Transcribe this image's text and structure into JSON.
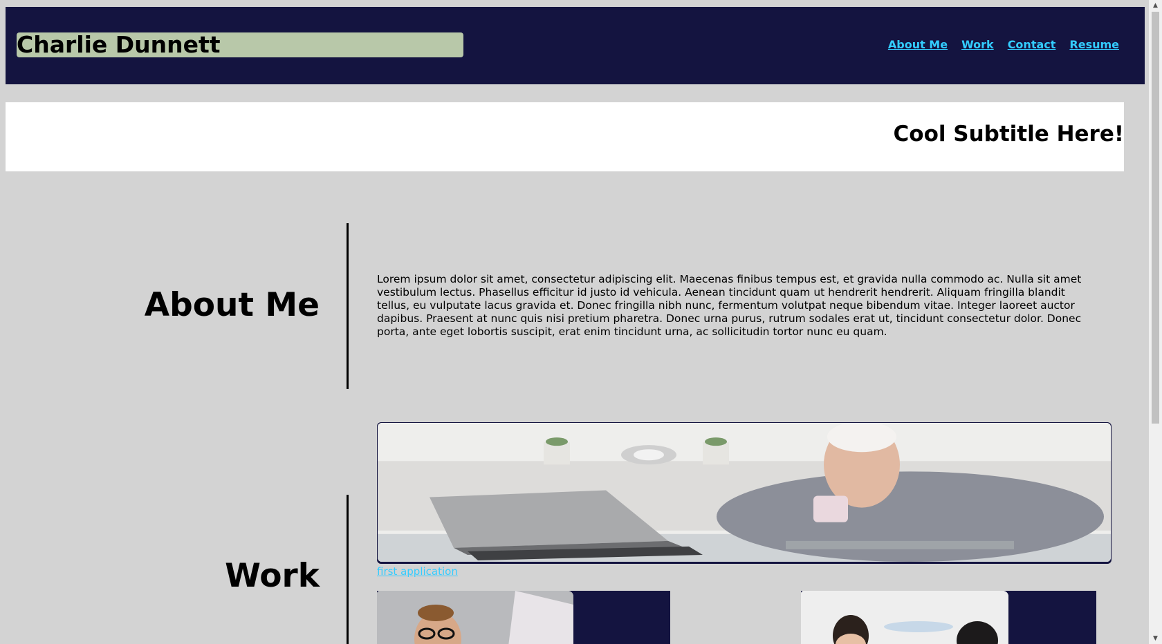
{
  "header": {
    "name": "Charlie Dunnett",
    "nav": [
      "About Me",
      "Work",
      "Contact",
      "Resume"
    ]
  },
  "hero": {
    "subtitle": "Cool Subtitle Here!"
  },
  "about": {
    "title": "About Me",
    "text": "Lorem ipsum dolor sit amet, consectetur adipiscing elit. Maecenas finibus tempus est, et gravida nulla commodo ac. Nulla sit amet vestibulum lectus. Phasellus efficitur id justo id vehicula. Aenean tincidunt quam ut hendrerit hendrerit. Aliquam fringilla blandit tellus, eu vulputate lacus gravida et. Donec fringilla nibh nunc, fermentum volutpat neque bibendum vitae. Integer laoreet auctor dapibus. Praesent at nunc quis nisi pretium pharetra. Donec urna purus, rutrum sodales erat ut, tincidunt consectetur dolor. Donec porta, ante eget lobortis suscipit, erat enim tincidunt urna, ac sollicitudin tortor nunc eu quam."
  },
  "work": {
    "title": "Work",
    "feature_link": "first application"
  },
  "colors": {
    "header_bg": "#141440",
    "name_bg": "#b8c8a9",
    "link": "#33ccff",
    "page_bg": "#d3d3d3"
  }
}
